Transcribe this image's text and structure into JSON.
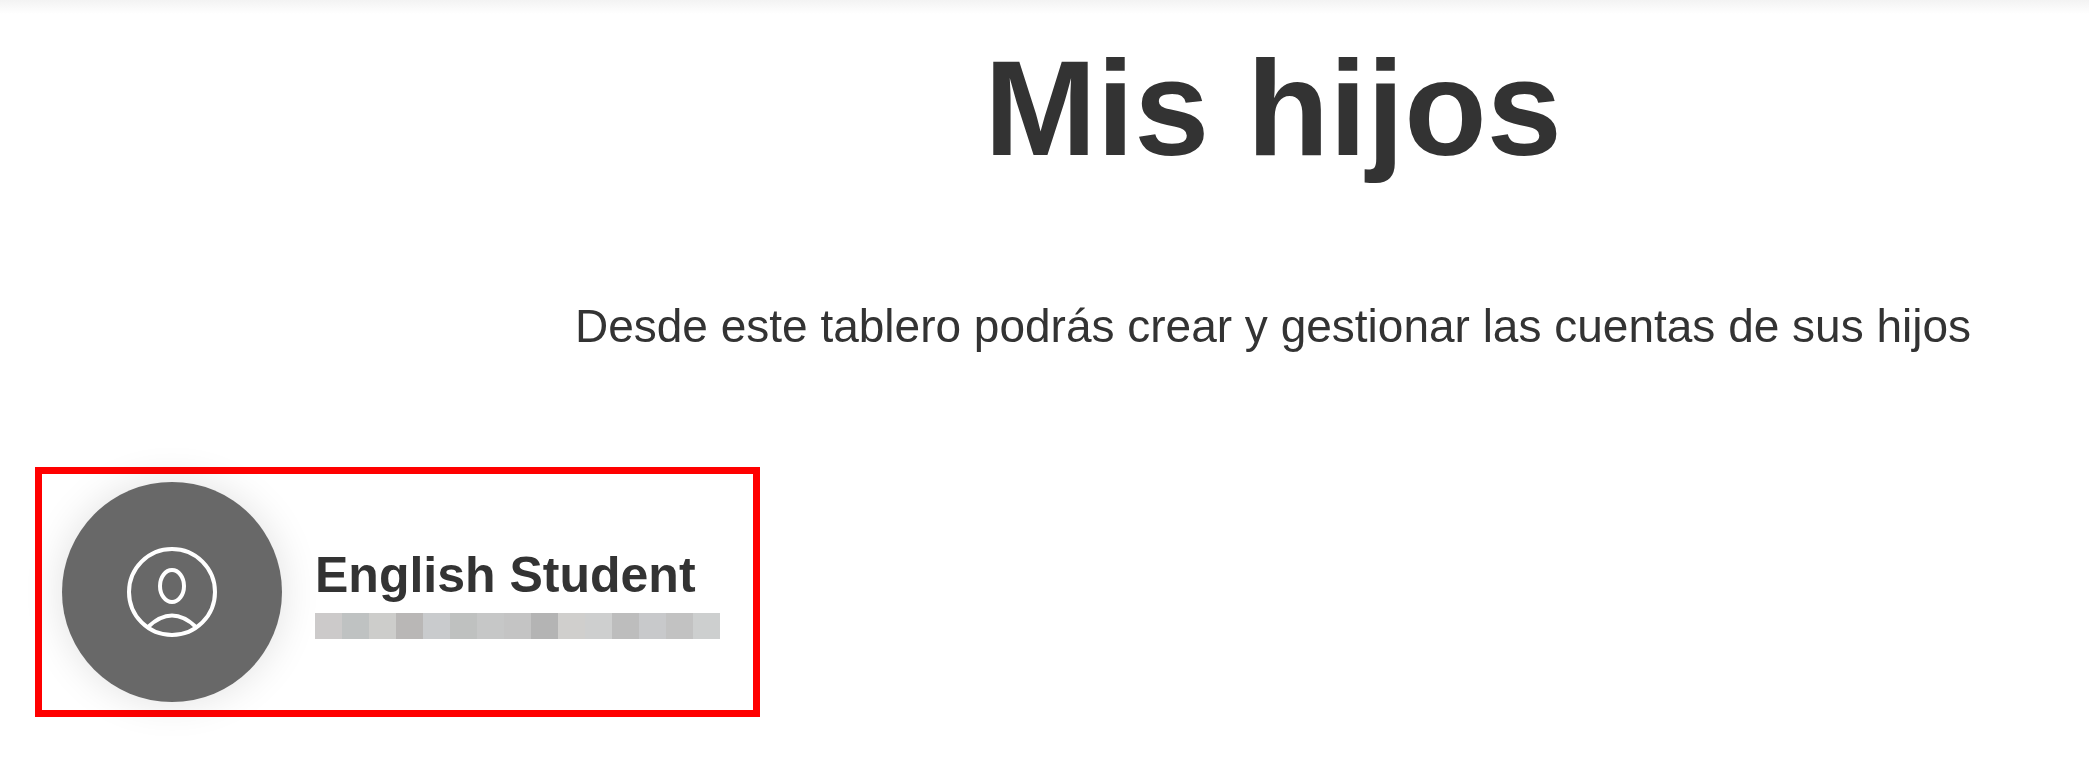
{
  "title": "Mis hijos",
  "subtitle": "Desde este tablero podrás crear y gestionar las cuentas de sus hijos",
  "children": [
    {
      "name": "English Student",
      "highlighted": true
    }
  ]
}
